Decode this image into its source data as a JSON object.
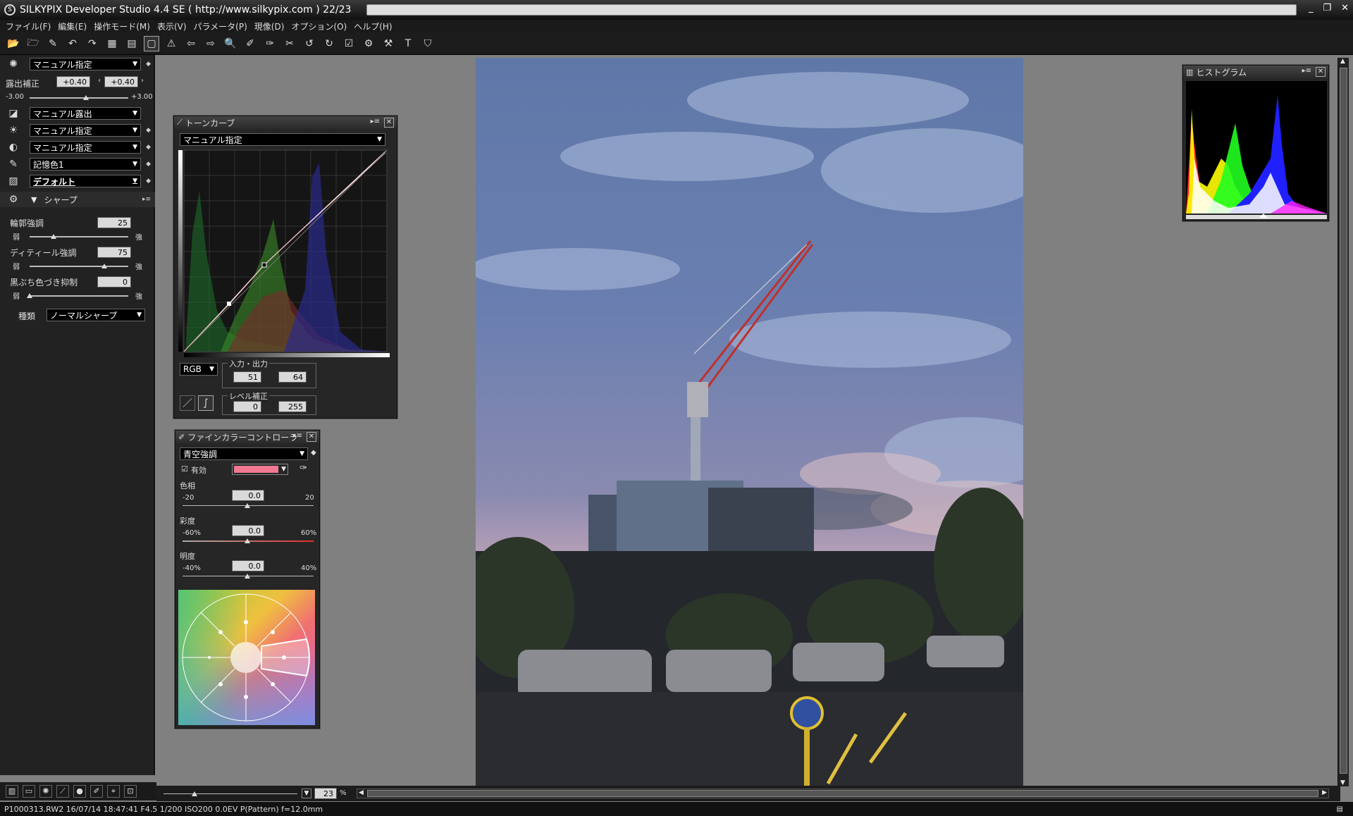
{
  "window": {
    "title": "SILKYPIX Developer Studio 4.4 SE ( http://www.silkypix.com )  22/23",
    "minimize": "_",
    "restore": "❐",
    "close": "✕"
  },
  "menu": [
    "ファイル(F)",
    "編集(E)",
    "操作モード(M)",
    "表示(V)",
    "パラメータ(P)",
    "現像(D)",
    "オプション(O)",
    "ヘルプ(H)"
  ],
  "left": {
    "wb_mode": "マニュアル指定",
    "exposure_label": "露出補正",
    "exposure_value_a": "+0.40",
    "exposure_value_b": "+0.40",
    "exposure_min": "-3.00",
    "exposure_max": "+3.00",
    "tone_mode": "マニュアル露出",
    "color_mode": "マニュアル指定",
    "contrast_mode": "マニュアル指定",
    "memory_color": "記憶色1",
    "style": "デフォルト",
    "sharp_title": "シャープ",
    "outline_label": "輪郭強調",
    "outline_value": "25",
    "detail_label": "ディティール強調",
    "detail_value": "75",
    "black_label": "黒ぶち色づき抑制",
    "black_value": "0",
    "weak": "弱",
    "strong": "強",
    "type_label": "種類",
    "type_value": "ノーマルシャープ"
  },
  "tonecurve": {
    "title": "トーンカーブ",
    "mode": "マニュアル指定",
    "channel": "RGB",
    "io_label": "入力・出力",
    "input": "51",
    "output": "64",
    "level_label": "レベル補正",
    "level_min": "0",
    "level_max": "255"
  },
  "finecolor": {
    "title": "ファインカラーコントローラ",
    "preset": "青空強調",
    "enabled_label": "有効",
    "swatch_color": "#f07890",
    "hue_label": "色相",
    "hue_value": "0.0",
    "hue_min": "-20",
    "hue_max": "20",
    "sat_label": "彩度",
    "sat_value": "0.0",
    "sat_min": "-60%",
    "sat_max": "60%",
    "bright_label": "明度",
    "bright_value": "0.0",
    "bright_min": "-40%",
    "bright_max": "40%"
  },
  "histogram": {
    "title": "ヒストグラム"
  },
  "zoom": {
    "value": "23",
    "unit": "%"
  },
  "status": "P1000313.RW2 16/07/14 18:47:41 F4.5 1/200 ISO200  0.0EV P(Pattern) f=12.0mm"
}
